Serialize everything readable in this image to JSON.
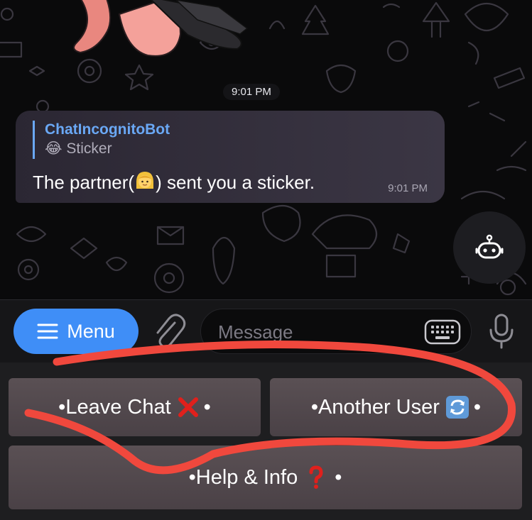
{
  "chat": {
    "date_time_chip": "9:01 PM",
    "message": {
      "reply_to_name": "ChatIncognitoBot",
      "reply_emoji": "😂",
      "reply_preview": "Sticker",
      "text_before": "The partner(",
      "text_after": ") sent you a sticker.",
      "time": "9:01 PM"
    }
  },
  "input_bar": {
    "menu_label": "Menu",
    "placeholder": "Message"
  },
  "bot_keyboard": {
    "buttons": [
      {
        "label": "•Leave Chat",
        "icon": "cross-mark-icon"
      },
      {
        "label": "•Another User",
        "icon": "refresh-arrows-icon"
      },
      {
        "label": "•Help & Info",
        "icon": "red-question-icon"
      }
    ],
    "suffix": "•"
  },
  "colors": {
    "accent": "#3f8ef7",
    "reply_name": "#6aa8f5",
    "annotation_stroke": "#f0483d"
  }
}
